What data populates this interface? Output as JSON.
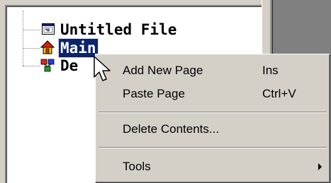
{
  "tree": {
    "nodes": [
      {
        "label": "Untitled File",
        "icon": "file-window-icon",
        "selected": false
      },
      {
        "label": "Main",
        "icon": "home-icon",
        "selected": true
      },
      {
        "label": "De",
        "icon": "network-pages-icon",
        "selected": false
      }
    ]
  },
  "context_menu": {
    "items": [
      {
        "label": "Add New Page",
        "shortcut": "Ins"
      },
      {
        "label": "Paste Page",
        "shortcut": "Ctrl+V"
      },
      {
        "label": "Delete Contents...",
        "shortcut": ""
      },
      {
        "label": "Tools",
        "shortcut": "",
        "has_submenu": true
      }
    ]
  },
  "colors": {
    "window_face": "#d4d0c8",
    "selection": "#0a246a",
    "panel_dark": "#808080"
  }
}
